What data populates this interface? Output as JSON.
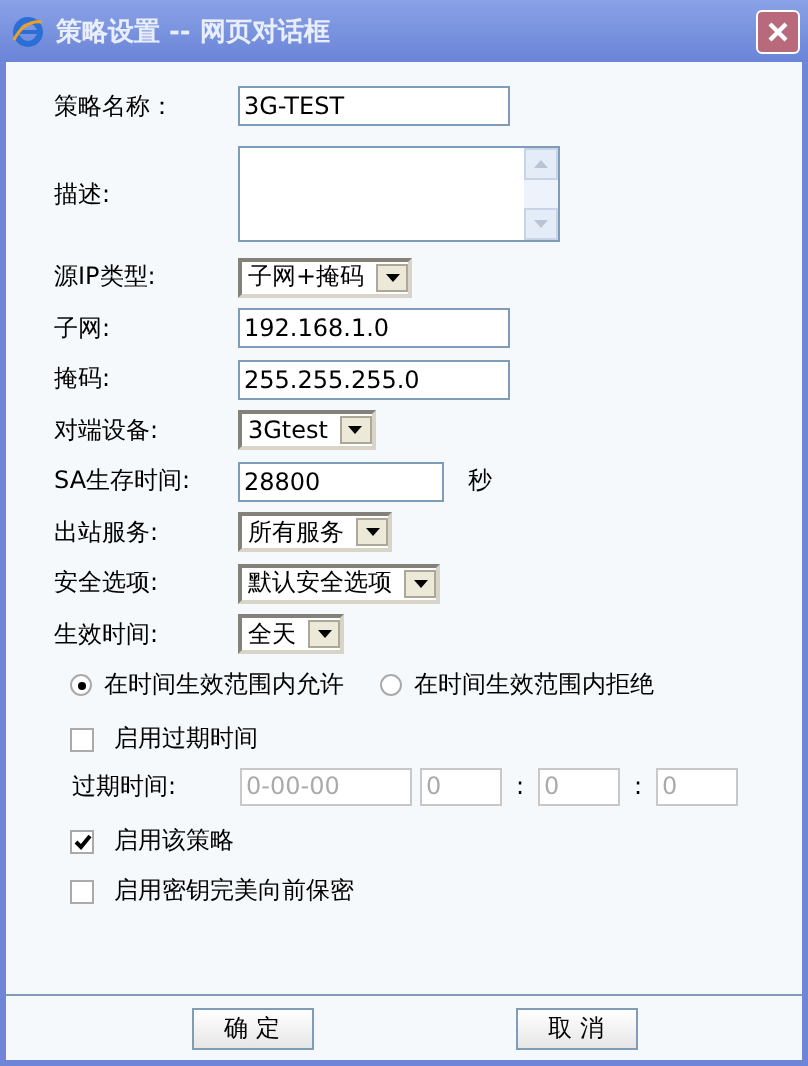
{
  "window": {
    "title": "策略设置 -- 网页对话框"
  },
  "fields": [
    {
      "kind": "text",
      "label": "策略名称：",
      "value": "3G-TEST"
    },
    {
      "kind": "textarea",
      "label": "描述:"
    },
    {
      "kind": "select",
      "label": "源IP类型:",
      "value": "子网+掩码"
    },
    {
      "kind": "text",
      "label": "子网:",
      "value": "192.168.1.0"
    },
    {
      "kind": "text",
      "label": "掩码:",
      "value": "255.255.255.0"
    },
    {
      "kind": "select",
      "label": "对端设备:",
      "value": "3Gtest"
    },
    {
      "kind": "text",
      "label": "SA生存时间:",
      "value": "28800",
      "unit": "秒"
    },
    {
      "kind": "select",
      "label": "出站服务:",
      "value": "所有服务"
    },
    {
      "kind": "select",
      "label": "安全选项:",
      "value": "默认安全选项"
    },
    {
      "kind": "select",
      "label": "生效时间:",
      "value": "全天"
    }
  ],
  "radios": [
    {
      "label": "在时间生效范围内允许",
      "selected": true
    },
    {
      "label": "在时间生效范围内拒绝",
      "selected": false
    }
  ],
  "expiry_checkbox": {
    "label": "启用过期时间",
    "checked": false
  },
  "expiry": {
    "label": "过期时间:",
    "date": "0-00-00",
    "hour": "0",
    "minute": "0",
    "second": "0",
    "separators": [
      ":",
      ":"
    ],
    "disabled": true
  },
  "checkboxes": [
    {
      "label": "启用该策略",
      "checked": true
    },
    {
      "label": "启用密钥完美向前保密",
      "checked": false
    }
  ],
  "buttons": [
    "确 定",
    "取 消"
  ]
}
